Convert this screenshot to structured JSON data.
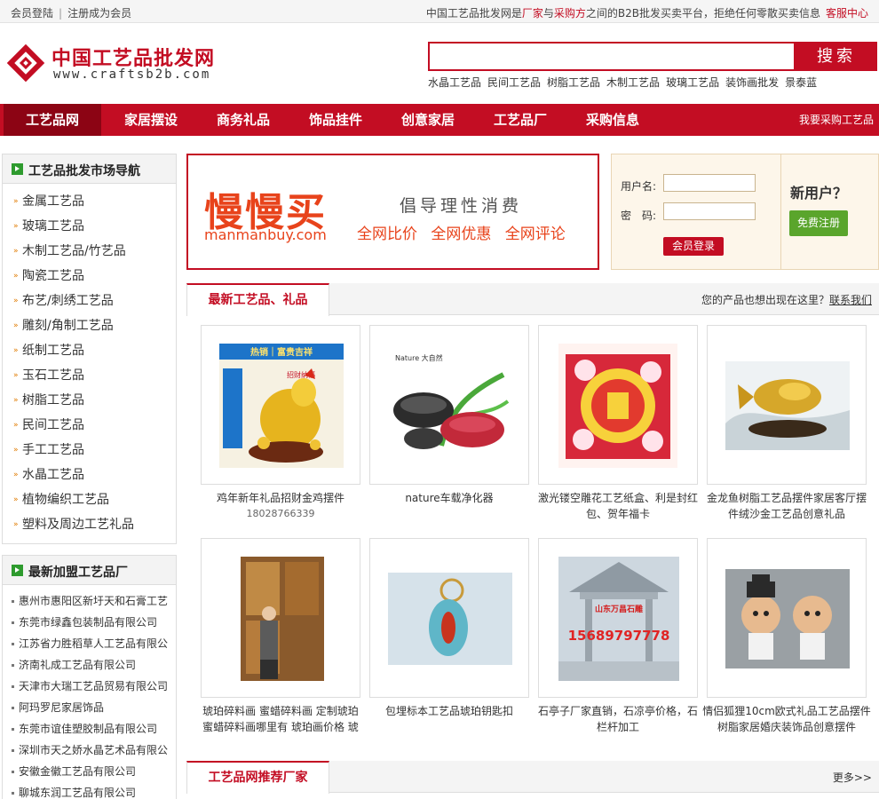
{
  "topbar": {
    "login": "会员登陆",
    "register": "注册成为会员",
    "intro_a": "中国工艺品批发网是",
    "intro_b": "厂家",
    "intro_c": "与",
    "intro_d": "采购方",
    "intro_e": "之间的B2B批发买卖平台，拒绝任何零散买卖信息",
    "service": "客服中心"
  },
  "logo": {
    "name": "中国工艺品批发网",
    "url": "www.craftsb2b.com"
  },
  "search": {
    "button": "搜索",
    "value": "",
    "hotwords": [
      "水晶工艺品",
      "民间工艺品",
      "树脂工艺品",
      "木制工艺品",
      "玻璃工艺品",
      "装饰画批发",
      "景泰蓝"
    ]
  },
  "nav": {
    "items": [
      "工艺品网",
      "家居摆设",
      "商务礼品",
      "饰品挂件",
      "创意家居",
      "工艺品厂",
      "采购信息"
    ],
    "buy": "我要采购工艺品"
  },
  "categories": {
    "title": "工艺品批发市场导航",
    "items": [
      "金属工艺品",
      "玻璃工艺品",
      "木制工艺品/竹艺品",
      "陶瓷工艺品",
      "布艺/刺绣工艺品",
      "雕刻/角制工艺品",
      "纸制工艺品",
      "玉石工艺品",
      "树脂工艺品",
      "民间工艺品",
      "手工工艺品",
      "水晶工艺品",
      "植物编织工艺品",
      "塑料及周边工艺礼品"
    ]
  },
  "firms": {
    "title": "最新加盟工艺品厂",
    "items": [
      "惠州市惠阳区新圩天和石膏工艺",
      "东莞市绿鑫包装制品有限公司",
      "江苏省力胜稻草人工艺品有限公",
      "济南礼成工艺品有限公司",
      "天津市大瑞工艺品贸易有限公司",
      "阿玛罗尼家居饰品",
      "东莞市谊佳塑胶制品有限公司",
      "深圳市天之娇水晶艺术品有限公",
      "安徽金徽工艺品有限公司",
      "聊城东润工艺品有限公司"
    ]
  },
  "banner": {
    "big": "慢慢买",
    "domain": "manmanbuy.com",
    "slogan": "倡导理性消费",
    "features": "全网比价 全网优惠 全网评论"
  },
  "login": {
    "username_label": "用户名:",
    "password_label": "密　码:",
    "login_button": "会员登录",
    "new_user": "新用户？",
    "register_button": "免费注册"
  },
  "latest": {
    "title": "最新工艺品、礼品",
    "right_text": "您的产品也想出现在这里？",
    "right_link": "联系我们",
    "products": [
      {
        "line1": "鸡年新年礼品招财金鸡摆件",
        "line2": "18028766339",
        "img_text_a": "热销｜富贵吉祥",
        "img_text_b": "招财纳福"
      },
      {
        "line1": "nature车载净化器",
        "line2": "",
        "img_text_a": "Nature 大自然",
        "img_text_b": ""
      },
      {
        "line1": "激光镂空雕花工艺纸盒、利是封红",
        "line2": "包、贺年福卡",
        "img_text_a": "",
        "img_text_b": ""
      },
      {
        "line1": "金龙鱼树脂工艺品摆件家居客厅摆",
        "line2": "件绒沙金工艺品创意礼品",
        "img_text_a": "",
        "img_text_b": ""
      },
      {
        "line1": "琥珀碎料画 蜜蜡碎料画 定制琥珀",
        "line2": "蜜蜡碎料画哪里有 琥珀画价格 琥",
        "img_text_a": "",
        "img_text_b": ""
      },
      {
        "line1": "包埋标本工艺品琥珀钥匙扣",
        "line2": "",
        "img_text_a": "",
        "img_text_b": ""
      },
      {
        "line1": "石亭子厂家直销，石凉亭价格，石",
        "line2": "栏杆加工",
        "img_text_a": "山东万昌石雕",
        "img_text_b": "15689797778"
      },
      {
        "line1": "情侣狐狸10cm欧式礼品工艺品摆件",
        "line2": "树脂家居婚庆装饰品创意摆件",
        "img_text_a": "",
        "img_text_b": ""
      }
    ]
  },
  "recommend": {
    "title": "工艺品网推荐厂家",
    "more": "更多>>"
  },
  "colors": {
    "brand": "#c30d23",
    "green": "#5aa52c",
    "banner_orange": "#e8431b"
  }
}
